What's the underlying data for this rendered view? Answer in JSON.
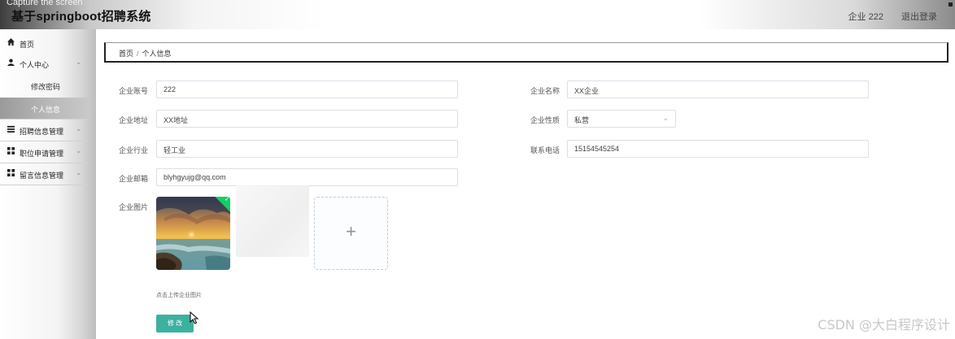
{
  "header": {
    "capture_text": "Capture the screen",
    "title": "基于springboot招聘系统",
    "user": "企业 222",
    "logout": "退出登录"
  },
  "sidebar": {
    "items": [
      {
        "label": "首页",
        "icon": "home-icon"
      },
      {
        "label": "个人中心",
        "icon": "user-icon",
        "expanded": true
      },
      {
        "label": "招聘信息管理",
        "icon": "list-icon"
      },
      {
        "label": "职位申请管理",
        "icon": "grid-icon"
      },
      {
        "label": "留言信息管理",
        "icon": "grid-icon"
      }
    ],
    "sub_items": [
      {
        "label": "修改密码"
      },
      {
        "label": "个人信息",
        "active": true
      }
    ]
  },
  "breadcrumb": {
    "home": "首页",
    "separator": "/",
    "current": "个人信息"
  },
  "form": {
    "account_label": "企业账号",
    "account_value": "222",
    "name_label": "企业名称",
    "name_value": "XX企业",
    "address_label": "企业地址",
    "address_value": "XX地址",
    "nature_label": "企业性质",
    "nature_value": "私营",
    "industry_label": "企业行业",
    "industry_value": "轻工业",
    "phone_label": "联系电话",
    "phone_value": "15154545254",
    "email_label": "企业邮箱",
    "email_value": "blyhgyujg@qq.com",
    "image_label": "企业图片",
    "upload_tip": "点击上传企业图片",
    "submit_label": "修 改"
  },
  "watermark": "CSDN @大白程序设计",
  "colors": {
    "accent": "#3cb1a0",
    "success": "#13ce66",
    "border": "#dcdfe6"
  }
}
